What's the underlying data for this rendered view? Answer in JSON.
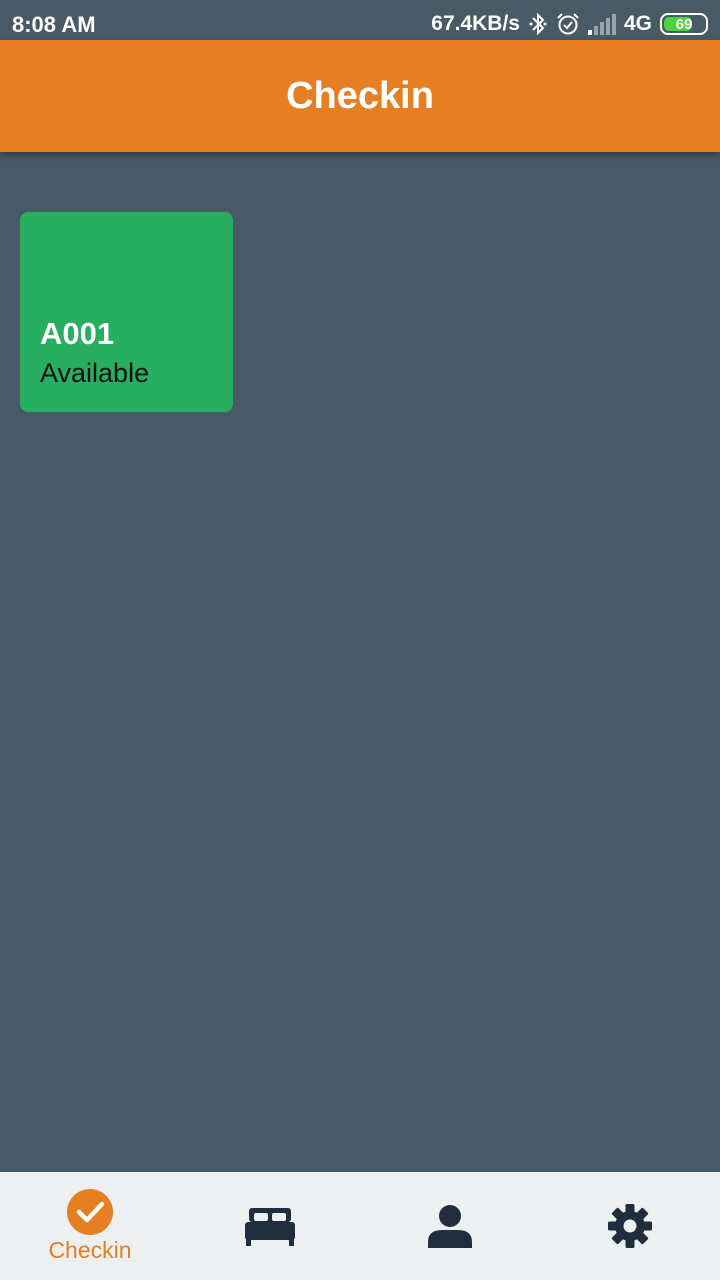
{
  "status_bar": {
    "time": "8:08 AM",
    "net_speed": "67.4KB/s",
    "network_type": "4G",
    "battery_level": "69",
    "battery_fraction": 0.69,
    "icons": [
      "bluetooth-icon",
      "alarm-icon",
      "signal-icon",
      "battery-icon"
    ]
  },
  "app_bar": {
    "title": "Checkin"
  },
  "rooms": [
    {
      "code": "A001",
      "status": "Available",
      "color": "#27ae60"
    }
  ],
  "bottom_nav": {
    "active_color": "#e67e22",
    "inactive_color": "#1f2d3d",
    "items": [
      {
        "icon": "checkin-icon",
        "label": "Checkin",
        "active": true
      },
      {
        "icon": "bed-icon",
        "label": "",
        "active": false
      },
      {
        "icon": "person-icon",
        "label": "",
        "active": false
      },
      {
        "icon": "gear-icon",
        "label": "",
        "active": false
      }
    ]
  },
  "colors": {
    "primary": "#e67e22",
    "background": "#485a66",
    "nav_background": "#ecf0f1"
  }
}
